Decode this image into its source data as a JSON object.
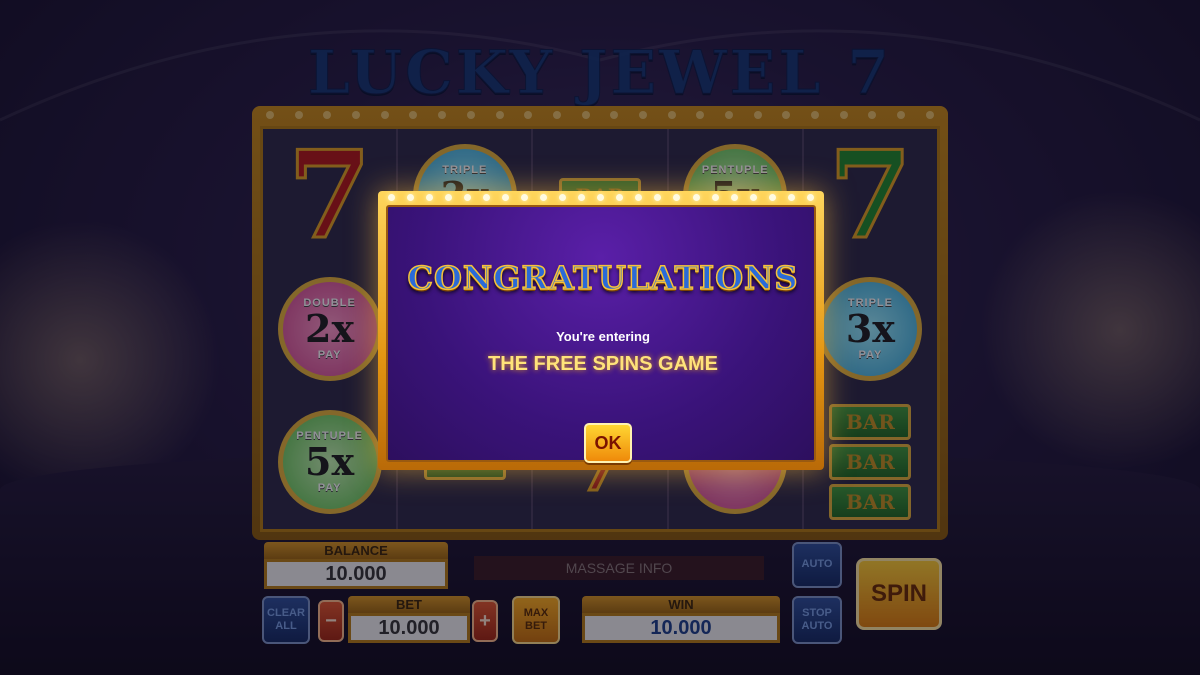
{
  "game": {
    "title": "LUCKY JEWEL 7"
  },
  "reels": {
    "reel1": [
      "7",
      "DOUBLE 2x PAY",
      "PENTUPLE 5x PAY"
    ],
    "reel5": [
      "7",
      "TRIPLE 3x PAY",
      "BAR BAR BAR"
    ]
  },
  "symbols": {
    "seven": "7",
    "bar": "BAR",
    "double": {
      "top": "DOUBLE",
      "mult": "2x",
      "bot": "PAY"
    },
    "triple": {
      "top": "TRIPLE",
      "mult": "3x",
      "bot": "PAY"
    },
    "pentuple": {
      "top": "PENTUPLE",
      "mult": "5x",
      "bot": "PAY"
    }
  },
  "controls": {
    "balance_label": "BALANCE",
    "balance_value": "10.000",
    "message": "MASSAGE INFO",
    "auto_label": "AUTO",
    "clear_all_label": "CLEAR ALL",
    "minus_label": "−",
    "bet_label": "BET",
    "bet_value": "10.000",
    "plus_label": "+",
    "max_bet_label": "MAX BET",
    "win_label": "WIN",
    "win_value": "10.000",
    "stop_auto_label": "STOP AUTO",
    "spin_label": "SPIN"
  },
  "modal": {
    "heading": "CONGRATULATIONS",
    "subtext": "You're entering",
    "message": "THE FREE SPINS GAME",
    "ok_label": "OK"
  },
  "colors": {
    "modal_bg": "#3a137a",
    "frame_gold": "#e39512",
    "heading_blue": "#2a6ad8",
    "message_yellow": "#ffe37a"
  }
}
